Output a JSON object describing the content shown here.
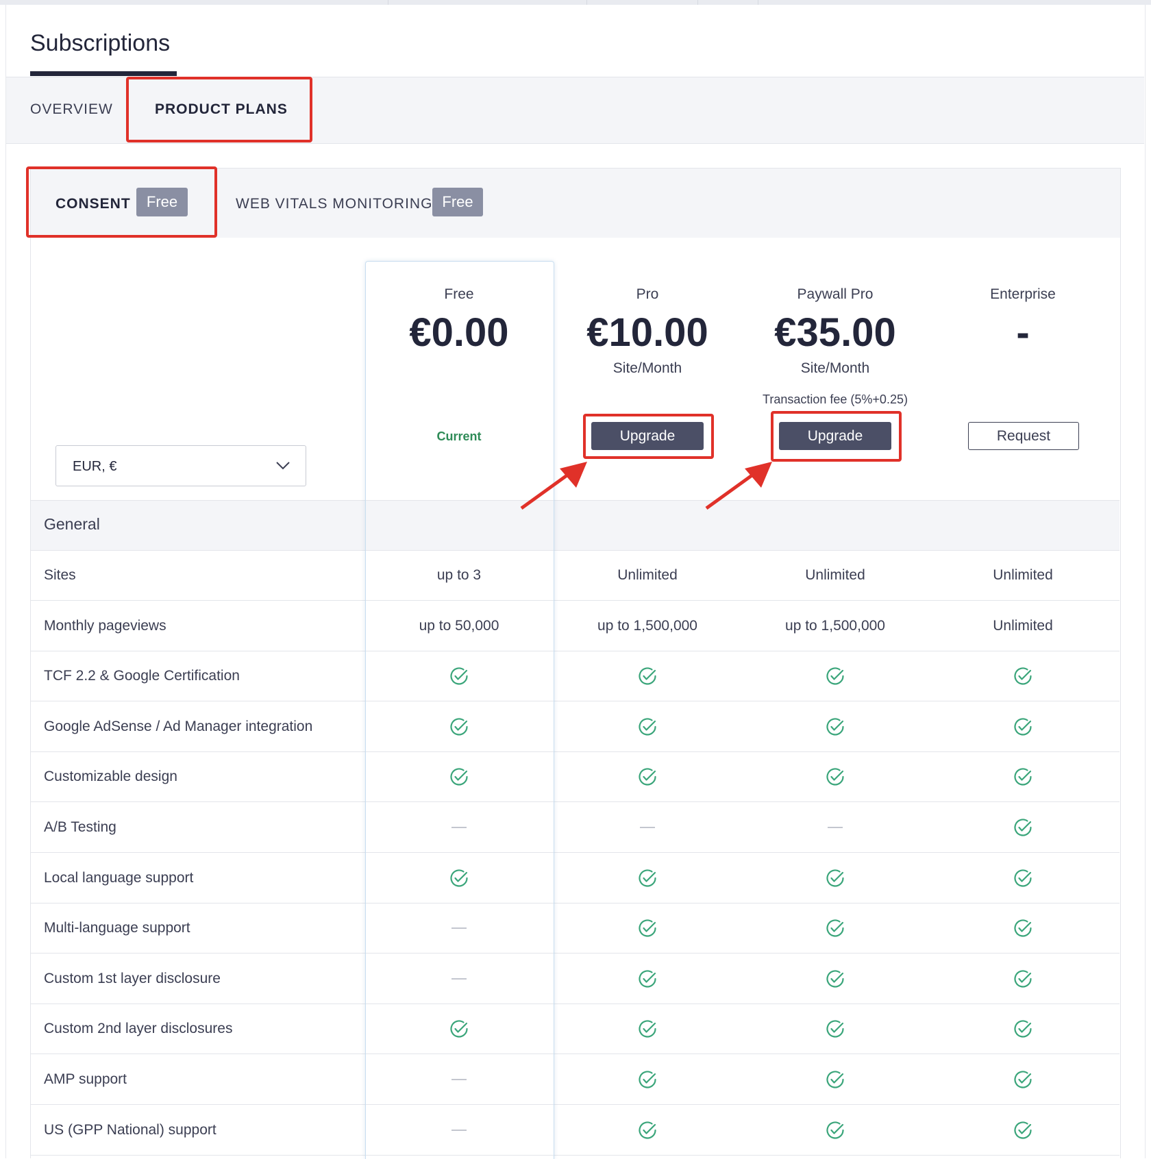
{
  "page": {
    "title": "Subscriptions"
  },
  "tabs": [
    {
      "label": "OVERVIEW",
      "active": false
    },
    {
      "label": "PRODUCT PLANS",
      "active": true
    }
  ],
  "product_tabs": [
    {
      "label": "CONSENT",
      "badge": "Free",
      "active": true
    },
    {
      "label": "WEB VITALS MONITORING",
      "badge": "Free",
      "active": false
    }
  ],
  "currency_select": {
    "value": "EUR, €"
  },
  "plans": [
    {
      "name": "Free",
      "price": "€0.00",
      "unit": "",
      "fee": "",
      "action": "Current",
      "action_type": "status"
    },
    {
      "name": "Pro",
      "price": "€10.00",
      "unit": "Site/Month",
      "fee": "",
      "action": "Upgrade",
      "action_type": "primary"
    },
    {
      "name": "Paywall Pro",
      "price": "€35.00",
      "unit": "Site/Month",
      "fee": "Transaction fee (5%+0.25)",
      "action": "Upgrade",
      "action_type": "primary"
    },
    {
      "name": "Enterprise",
      "price": "-",
      "unit": "",
      "fee": "",
      "action": "Request",
      "action_type": "outline"
    }
  ],
  "section": {
    "label": "General"
  },
  "features": [
    {
      "label": "Sites",
      "values": [
        "up to 3",
        "Unlimited",
        "Unlimited",
        "Unlimited"
      ]
    },
    {
      "label": "Monthly pageviews",
      "values": [
        "up to 50,000",
        "up to 1,500,000",
        "up to 1,500,000",
        "Unlimited"
      ]
    },
    {
      "label": "TCF 2.2 & Google Certification",
      "values": [
        "check",
        "check",
        "check",
        "check"
      ]
    },
    {
      "label": "Google AdSense / Ad Manager integration",
      "values": [
        "check",
        "check",
        "check",
        "check"
      ]
    },
    {
      "label": "Customizable design",
      "values": [
        "check",
        "check",
        "check",
        "check"
      ]
    },
    {
      "label": "A/B Testing",
      "values": [
        "dash",
        "dash",
        "dash",
        "check"
      ]
    },
    {
      "label": "Local language support",
      "values": [
        "check",
        "check",
        "check",
        "check"
      ]
    },
    {
      "label": "Multi-language support",
      "values": [
        "dash",
        "check",
        "check",
        "check"
      ]
    },
    {
      "label": "Custom 1st layer disclosure",
      "values": [
        "dash",
        "check",
        "check",
        "check"
      ]
    },
    {
      "label": "Custom 2nd layer disclosures",
      "values": [
        "check",
        "check",
        "check",
        "check"
      ]
    },
    {
      "label": "AMP support",
      "values": [
        "dash",
        "check",
        "check",
        "check"
      ]
    },
    {
      "label": "US (GPP National) support",
      "values": [
        "dash",
        "check",
        "check",
        "check"
      ]
    }
  ],
  "colors": {
    "check": "#3aa57a",
    "current": "#2e8b57",
    "annotation": "#e03129",
    "button_dark": "#4b4f66"
  }
}
